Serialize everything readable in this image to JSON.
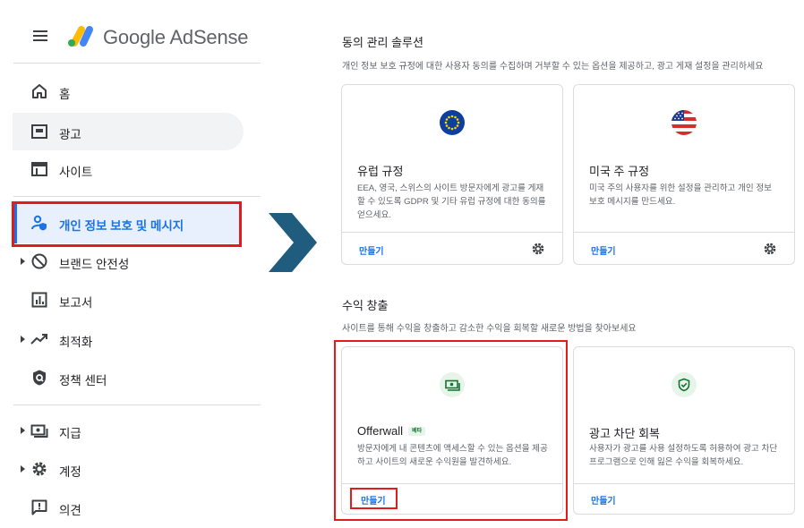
{
  "app": {
    "brand": "Google AdSense"
  },
  "sidebar": {
    "items": [
      {
        "label": "홈",
        "icon": "home-icon"
      },
      {
        "label": "광고",
        "icon": "ads-icon"
      },
      {
        "label": "사이트",
        "icon": "sites-icon"
      },
      {
        "label": "개인 정보 보호 및 메시지",
        "icon": "privacy-messaging-icon"
      },
      {
        "label": "브랜드 안전성",
        "icon": "block-icon"
      },
      {
        "label": "보고서",
        "icon": "reports-icon"
      },
      {
        "label": "최적화",
        "icon": "trending-icon"
      },
      {
        "label": "정책 센터",
        "icon": "policy-shield-icon"
      },
      {
        "label": "지급",
        "icon": "payments-icon"
      },
      {
        "label": "계정",
        "icon": "settings-gear-icon"
      },
      {
        "label": "의견",
        "icon": "feedback-icon"
      }
    ]
  },
  "consent": {
    "title": "동의 관리 솔루션",
    "subtitle": "개인 정보 보호 규정에 대한 사용자 동의를 수집하며 거부할 수 있는 옵션을 제공하고, 광고 게재 설정을 관리하세요",
    "cards": [
      {
        "title": "유럽 규정",
        "description": "EEA, 영국, 스위스의 사이트 방문자에게 광고를 게재할 수 있도록 GDPR 및 기타 유럽 규정에 대한 동의를 얻으세요.",
        "action": "만들기",
        "icon": "eu-flag-icon"
      },
      {
        "title": "미국 주 규정",
        "description": "미국 주의 사용자를 위한 설정을 관리하고 개인 정보 보호 메시지를 만드세요.",
        "action": "만들기",
        "icon": "us-flag-icon"
      }
    ]
  },
  "revenue": {
    "title": "수익 창출",
    "subtitle": "사이트를 통해 수익을 창출하고 감소한 수익을 회복할 새로운 방법을 찾아보세요",
    "cards": [
      {
        "title": "Offerwall",
        "badge": "베타",
        "description": "방문자에게 내 콘텐츠에 액세스할 수 있는 옵션을 제공하고 사이트의 새로운 수익원을 발견하세요.",
        "action": "만들기",
        "icon": "money-icon"
      },
      {
        "title": "광고 차단 회복",
        "description": "사용자가 광고를 사용 설정하도록 허용하여 광고 차단 프로그램으로 인해 잃은 수익을 회복하세요.",
        "action": "만들기",
        "icon": "shield-check-icon"
      }
    ]
  },
  "colors": {
    "accent": "#1a73e8",
    "highlight": "#e31b1b",
    "arrow": "#1f5c7e"
  }
}
